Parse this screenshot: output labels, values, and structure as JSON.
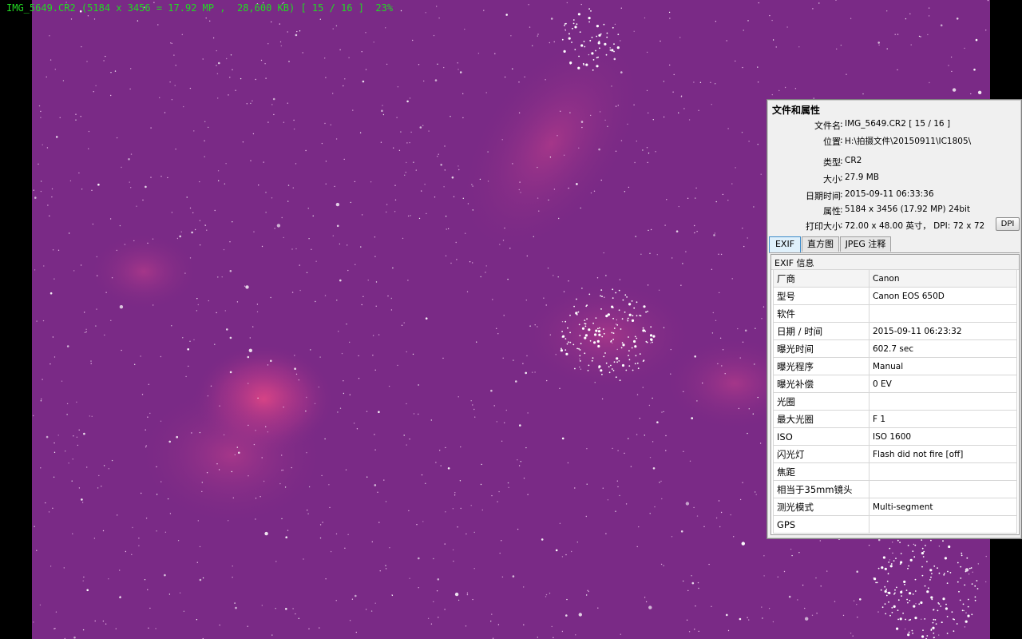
{
  "osd": {
    "text": "IMG_5649.CR2 (5184 x 3456 = 17.92 MP ,  28,600 KB) [ 15 / 16 ]  23%"
  },
  "colors": {
    "sky": "#7a2a86",
    "osd_text": "#22d922",
    "nebula": "#e0407e"
  },
  "panel": {
    "title": "文件和属性",
    "props": [
      {
        "label": "文件名",
        "value": "IMG_5649.CR2   [ 15 / 16 ]"
      },
      {
        "label": "位置",
        "value": "H:\\拍摄文件\\20150911\\IC1805\\"
      },
      {
        "label": "类型",
        "value": "CR2"
      },
      {
        "label": "大小",
        "value": "27.9 MB"
      },
      {
        "label": "日期时间",
        "value": "2015-09-11 06:33:36"
      },
      {
        "label": "属性",
        "value": "5184 x 3456 (17.92 MP)  24bit"
      },
      {
        "label": "打印大小",
        "value": "72.00 x 48.00 英寸，  DPI: 72 x 72"
      }
    ],
    "dpi_button": "DPI",
    "tabs": [
      "EXIF",
      "直方图",
      "JPEG 注释"
    ],
    "exif_header": "EXIF 信息",
    "exif_rows": [
      {
        "key": "厂商",
        "value": "Canon"
      },
      {
        "key": "型号",
        "value": "Canon EOS 650D"
      },
      {
        "key": "软件",
        "value": ""
      },
      {
        "key": "日期 / 时间",
        "value": "2015-09-11 06:23:32"
      },
      {
        "key": "曝光时间",
        "value": "602.7 sec"
      },
      {
        "key": "曝光程序",
        "value": "Manual"
      },
      {
        "key": "曝光补偿",
        "value": "0 EV"
      },
      {
        "key": "光圈",
        "value": ""
      },
      {
        "key": "最大光圈",
        "value": "F 1"
      },
      {
        "key": "ISO",
        "value": "ISO 1600"
      },
      {
        "key": "闪光灯",
        "value": "Flash did not fire [off]"
      },
      {
        "key": "焦距",
        "value": ""
      },
      {
        "key": "相当于35mm镜头",
        "value": ""
      },
      {
        "key": "测光模式",
        "value": "Multi-segment"
      },
      {
        "key": "GPS",
        "value": ""
      }
    ]
  }
}
